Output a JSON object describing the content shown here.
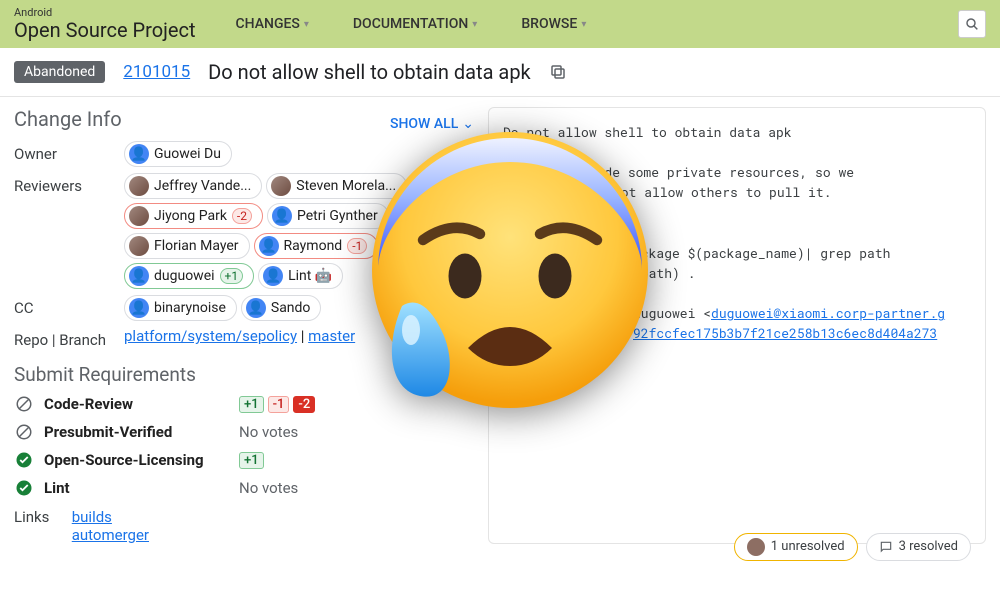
{
  "header": {
    "logo_sub": "Android",
    "logo_main": "Open Source Project",
    "nav": [
      "CHANGES",
      "DOCUMENTATION",
      "BROWSE"
    ]
  },
  "subhead": {
    "status": "Abandoned",
    "change_number": "2101015",
    "title": "Do not allow shell to obtain data apk"
  },
  "change_info": {
    "section_title": "Change Info",
    "show_all": "SHOW ALL",
    "owner_label": "Owner",
    "owner": "Guowei Du",
    "reviewers_label": "Reviewers",
    "reviewers": [
      {
        "name": "Jeffrey Vande...",
        "vote": null,
        "border": "plain",
        "avatar": "img"
      },
      {
        "name": "Steven Morela...",
        "vote": null,
        "border": "plain",
        "avatar": "img"
      },
      {
        "name": "Jiyong Park",
        "vote": "-2",
        "border": "red",
        "avatar": "img"
      },
      {
        "name": "Petri Gynther",
        "vote": null,
        "border": "plain",
        "avatar": "blue"
      },
      {
        "name": "Florian Mayer",
        "vote": null,
        "border": "plain",
        "avatar": "img"
      },
      {
        "name": "Raymond",
        "vote": "-1",
        "border": "red",
        "avatar": "blue"
      },
      {
        "name": "duguowei",
        "vote": "+1",
        "border": "green",
        "avatar": "blue"
      },
      {
        "name": "Lint 🤖",
        "vote": null,
        "border": "plain",
        "avatar": "blue"
      }
    ],
    "cc_label": "CC",
    "cc": [
      {
        "name": "binarynoise"
      },
      {
        "name": "Sando"
      }
    ],
    "repo_label": "Repo | Branch",
    "repo": "platform/system/sepolicy",
    "branch": "master"
  },
  "submit_req": {
    "title": "Submit Requirements",
    "rows": [
      {
        "status": "block",
        "name": "Code-Review",
        "votes": [
          "+1",
          "-1",
          "-2"
        ]
      },
      {
        "status": "block",
        "name": "Presubmit-Verified",
        "votes": [],
        "novotes": "No votes"
      },
      {
        "status": "ok",
        "name": "Open-Source-Licensing",
        "votes": [
          "+1"
        ]
      },
      {
        "status": "ok",
        "name": "Lint",
        "votes": [],
        "novotes": "No votes"
      }
    ]
  },
  "links": {
    "label": "Links",
    "items": [
      "builds",
      "automerger"
    ]
  },
  "commit": {
    "line1": "Do not allow shell to obtain data apk",
    "line2": "Apk may include some private resources, so we",
    "line3": "not allow others to pull it.",
    "line4": "ackage $(package_name)| grep path",
    "line5": "(path) .",
    "line6_pre": "duguowei <",
    "line6_link": "duguowei@xiaomi.corp-partner.g",
    "line7_link": "92fccfec175b3b7f21ce258b13c6ec8d404a273"
  },
  "comment_pills": {
    "unresolved": "1 unresolved",
    "resolved": "3 resolved"
  }
}
